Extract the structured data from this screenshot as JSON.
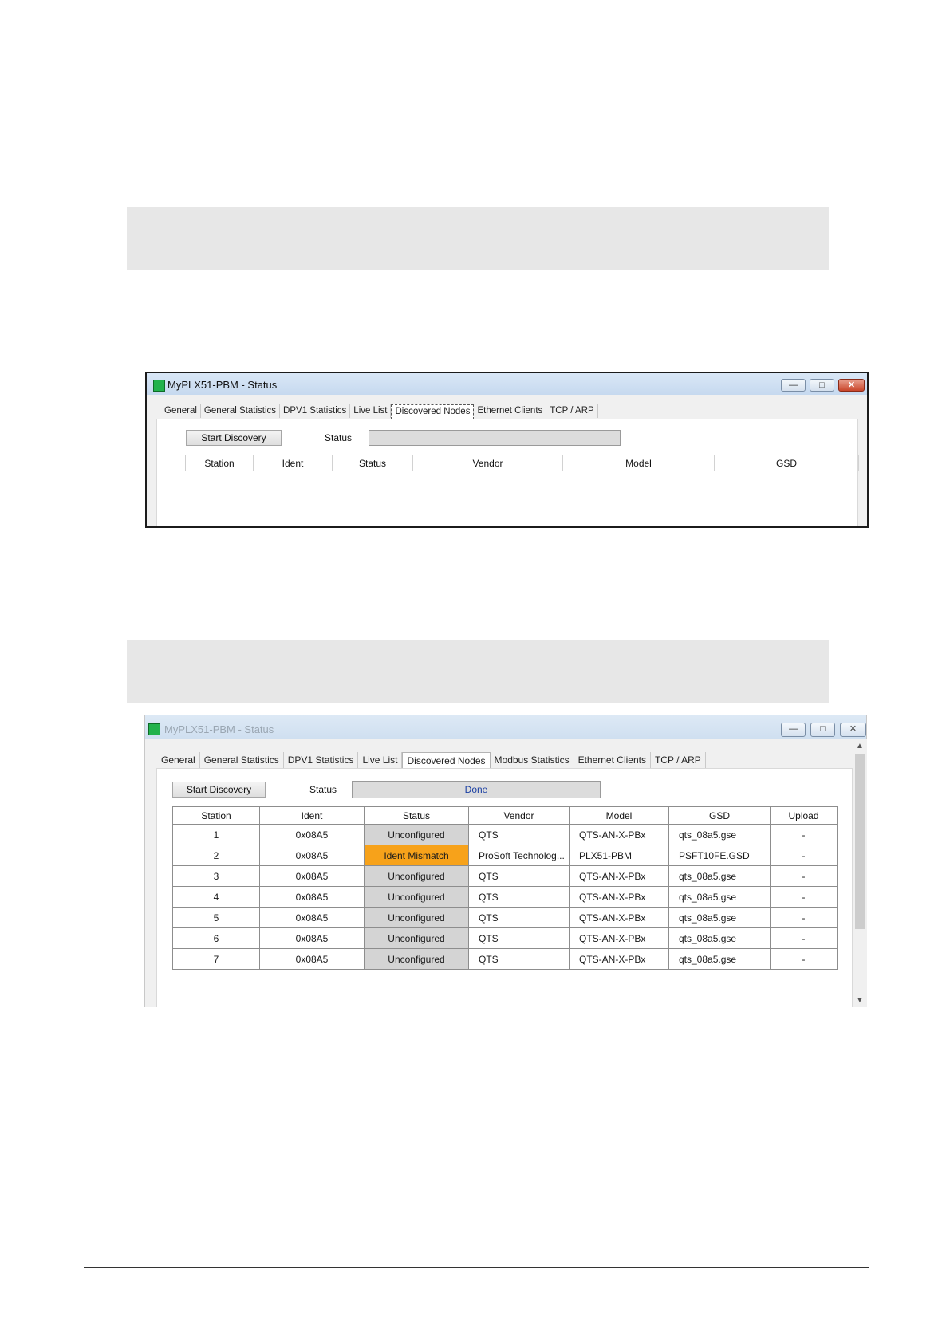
{
  "colors": {
    "accent_status_icon": "#22b24c",
    "mismatch": "#f7a21a",
    "unconfigured": "#d4d4d4",
    "done_text": "#1a3fa3"
  },
  "window1": {
    "title": "MyPLX51-PBM - Status",
    "icon": "status-square-icon",
    "tabs": [
      "General",
      "General Statistics",
      "DPV1 Statistics",
      "Live List",
      "Discovered Nodes",
      "Ethernet Clients",
      "TCP / ARP"
    ],
    "active_tab_index": 4,
    "start_label": "Start Discovery",
    "status_label": "Status",
    "status_value": "",
    "columns": [
      "Station",
      "Ident",
      "Status",
      "Vendor",
      "Model",
      "GSD"
    ],
    "caption_buttons": {
      "minimize": "—",
      "maximize": "□",
      "close": "✕"
    }
  },
  "window2": {
    "title": "MyPLX51-PBM - Status",
    "icon": "status-square-icon",
    "tabs": [
      "General",
      "General Statistics",
      "DPV1 Statistics",
      "Live List",
      "Discovered Nodes",
      "Modbus Statistics",
      "Ethernet Clients",
      "TCP / ARP"
    ],
    "active_tab_index": 4,
    "start_label": "Start Discovery",
    "status_label": "Status",
    "status_value": "Done",
    "columns": [
      "Station",
      "Ident",
      "Status",
      "Vendor",
      "Model",
      "GSD",
      "Upload"
    ],
    "rows": [
      [
        "1",
        "0x08A5",
        "Unconfigured",
        "QTS",
        "QTS-AN-X-PBx",
        "qts_08a5.gse",
        "-"
      ],
      [
        "2",
        "0x08A5",
        "Ident Mismatch",
        "ProSoft Technolog...",
        "PLX51-PBM",
        "PSFT10FE.GSD",
        "-"
      ],
      [
        "3",
        "0x08A5",
        "Unconfigured",
        "QTS",
        "QTS-AN-X-PBx",
        "qts_08a5.gse",
        "-"
      ],
      [
        "4",
        "0x08A5",
        "Unconfigured",
        "QTS",
        "QTS-AN-X-PBx",
        "qts_08a5.gse",
        "-"
      ],
      [
        "5",
        "0x08A5",
        "Unconfigured",
        "QTS",
        "QTS-AN-X-PBx",
        "qts_08a5.gse",
        "-"
      ],
      [
        "6",
        "0x08A5",
        "Unconfigured",
        "QTS",
        "QTS-AN-X-PBx",
        "qts_08a5.gse",
        "-"
      ],
      [
        "7",
        "0x08A5",
        "Unconfigured",
        "QTS",
        "QTS-AN-X-PBx",
        "qts_08a5.gse",
        "-"
      ]
    ],
    "caption_buttons": {
      "minimize": "—",
      "maximize": "□",
      "close": "✕"
    },
    "scroll_up": "▲",
    "scroll_down": "▼"
  }
}
